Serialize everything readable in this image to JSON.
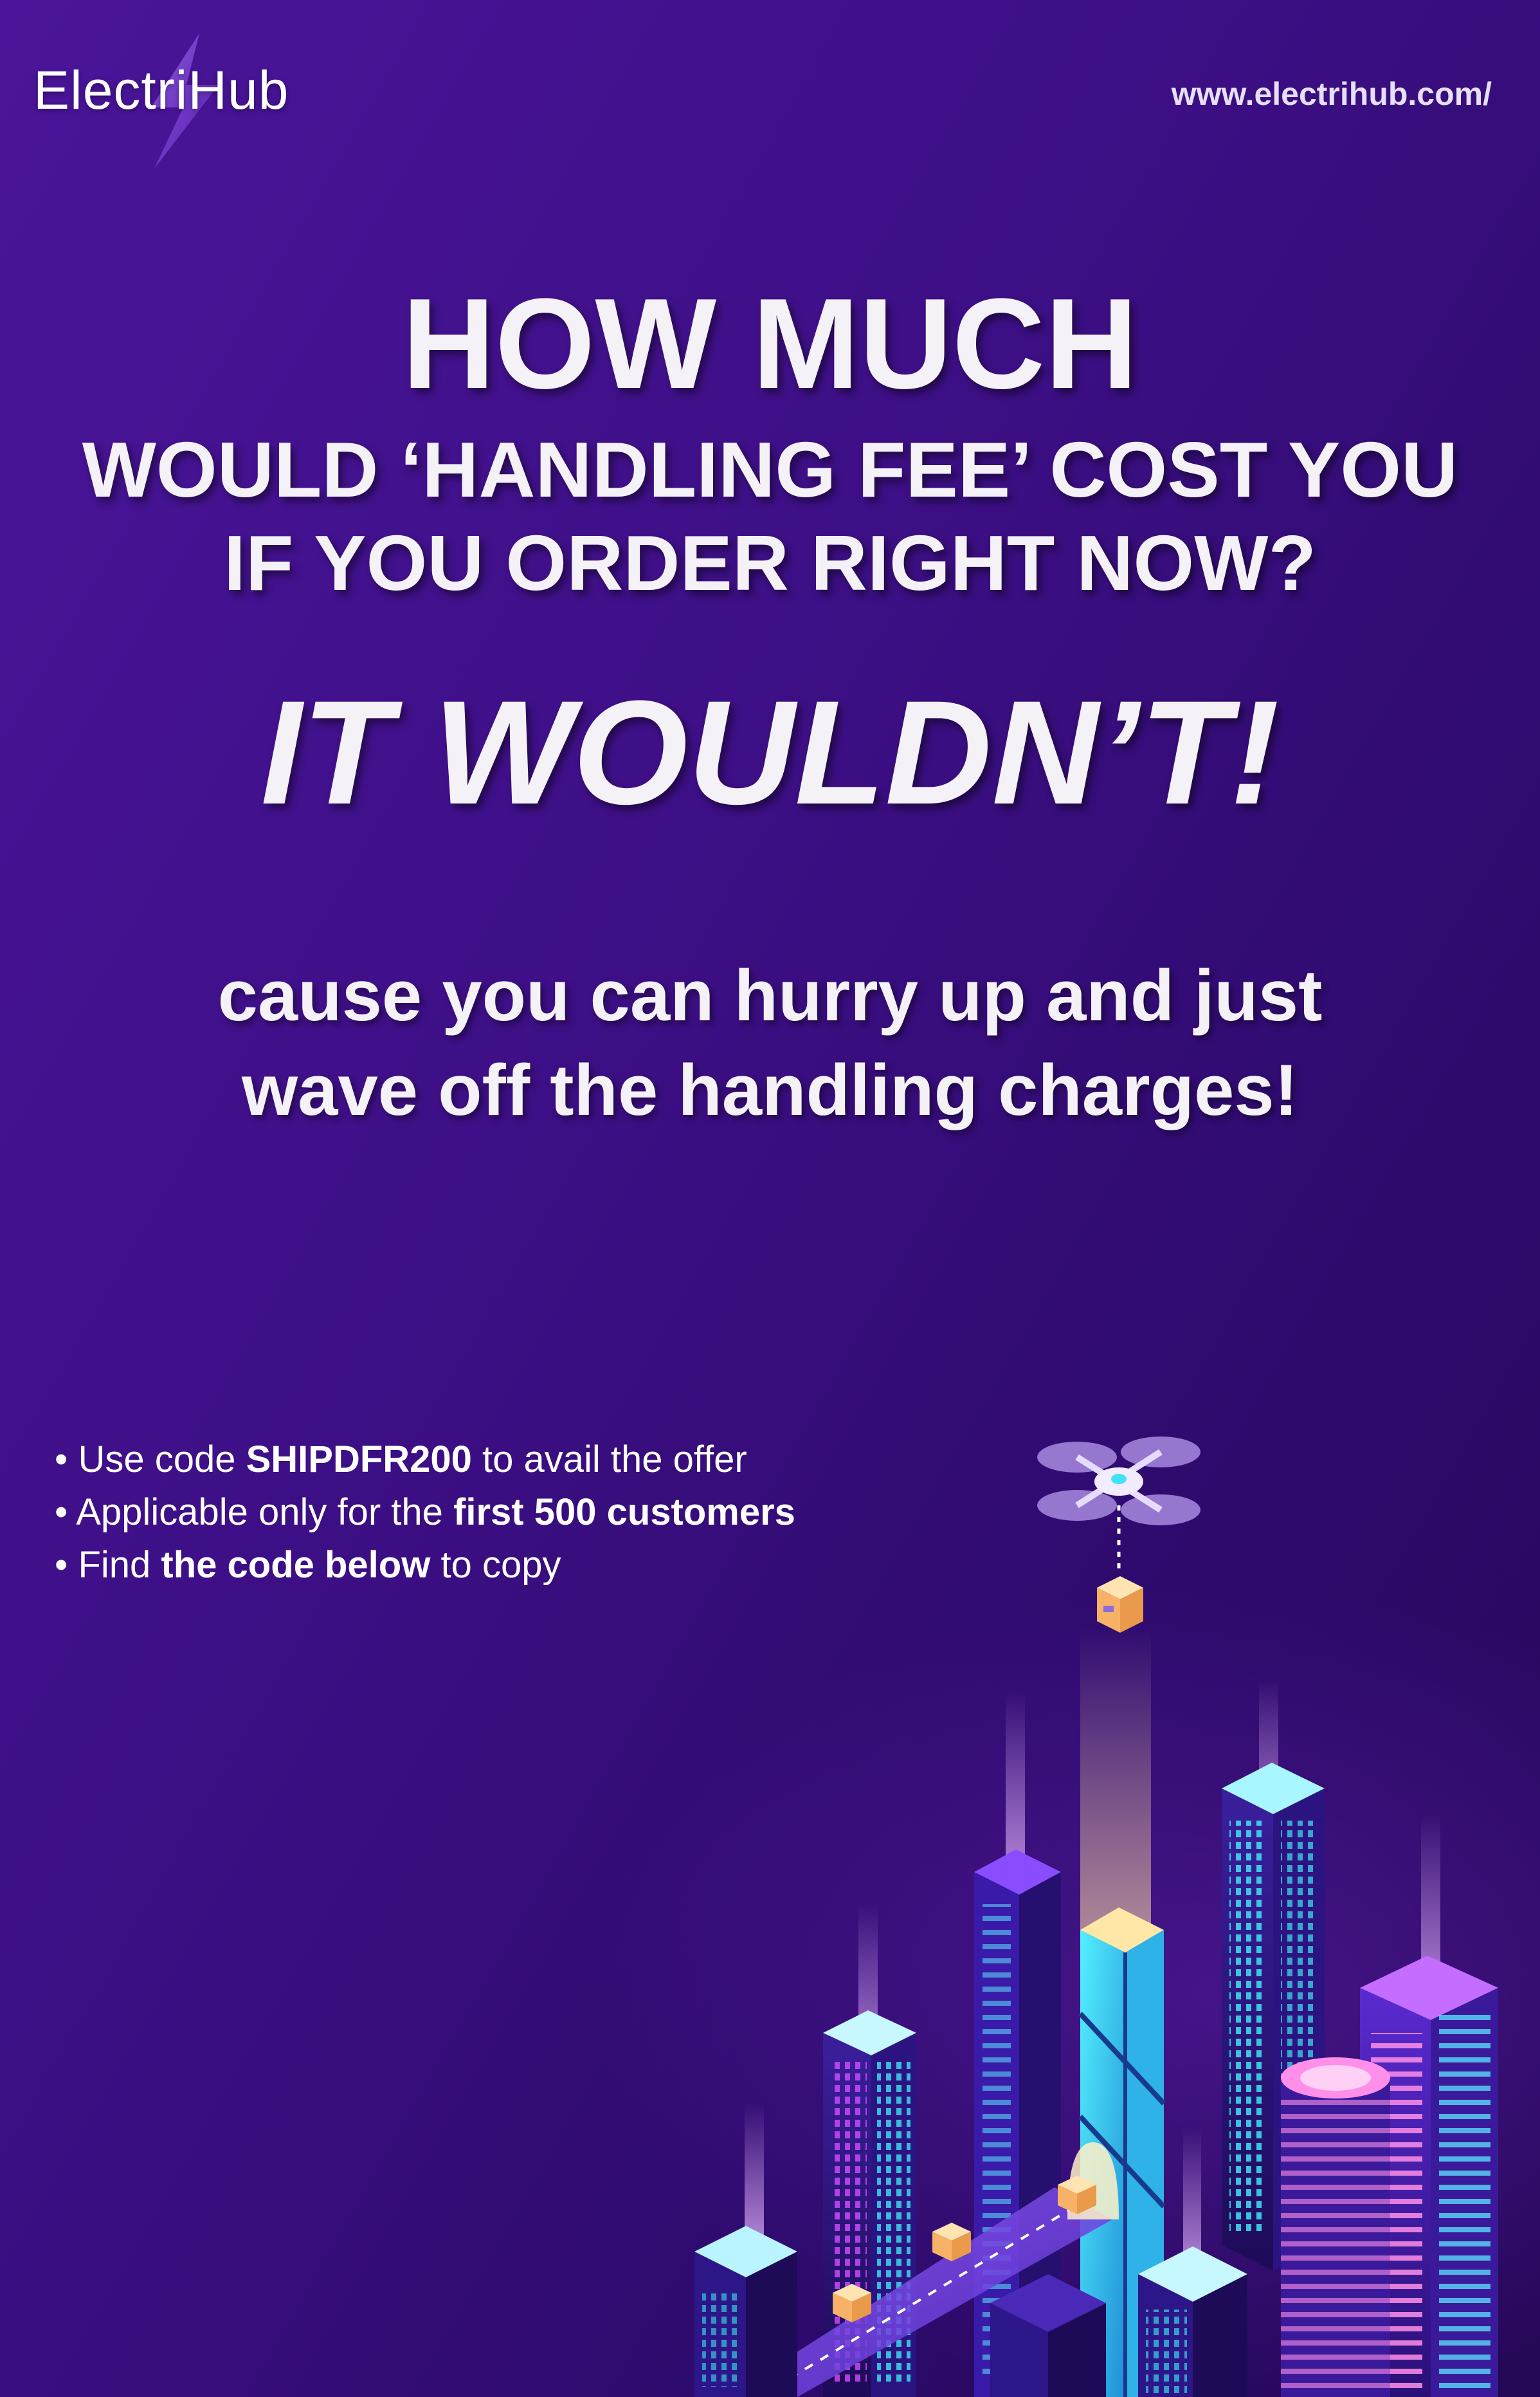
{
  "brand": {
    "name": "ElectriHub",
    "url": "www.electrihub.com/"
  },
  "headline": {
    "line1": "HOW MUCH",
    "line2": "WOULD ‘HANDLING FEE’ COST YOU",
    "line3": "IF YOU ORDER RIGHT NOW?",
    "line4": "IT WOULDN’T!"
  },
  "subline": {
    "line1": "cause you can hurry up and just",
    "line2": "wave off the handling charges!"
  },
  "offer": {
    "items": [
      {
        "bullet": "•",
        "pre": "Use code ",
        "bold": "SHIPDFR200",
        "post": " to avail the offer"
      },
      {
        "bullet": "•",
        "pre": "Applicable only for the ",
        "bold": "first 500 customers",
        "post": ""
      },
      {
        "bullet": "•",
        "pre": "Find ",
        "bold": "the code below",
        "post": " to copy"
      }
    ]
  },
  "colors": {
    "background_start": "#4a159a",
    "background_end": "#260858",
    "text": "#f4f2f7",
    "neon_cyan": "#3fe3f5",
    "neon_magenta": "#d44bff",
    "package": "#f7c77f"
  },
  "illustration": {
    "icons": [
      "lightning-bolt-icon",
      "drone-icon",
      "package-icon",
      "city-buildings"
    ]
  }
}
